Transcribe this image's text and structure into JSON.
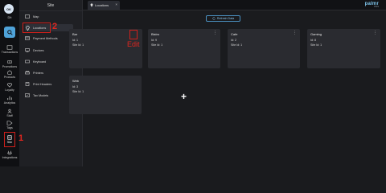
{
  "rail": {
    "avatar_initials": "OK",
    "user_label": "Dit",
    "items": [
      {
        "label": "Transactions",
        "icon": "transactions-icon"
      },
      {
        "label": "Promotions",
        "icon": "promotions-icon"
      },
      {
        "label": "Products",
        "icon": "products-icon"
      },
      {
        "label": "Loyalty",
        "icon": "loyalty-icon"
      },
      {
        "label": "Analytics",
        "icon": "analytics-icon"
      },
      {
        "label": "Staff",
        "icon": "staff-icon"
      },
      {
        "label": "Tags",
        "icon": "tags-icon"
      },
      {
        "label": "Site",
        "icon": "site-icon"
      },
      {
        "label": "Integrations",
        "icon": "integrations-icon"
      }
    ]
  },
  "panel": {
    "title": "Site",
    "items": [
      {
        "label": "Map",
        "icon": "map-icon"
      },
      {
        "label": "Locations",
        "icon": "location-pin-icon"
      },
      {
        "label": "Payment Methods",
        "icon": "payment-icon"
      },
      {
        "label": "Devices",
        "icon": "devices-icon"
      },
      {
        "label": "Keyboard",
        "icon": "keyboard-icon"
      },
      {
        "label": "Printers",
        "icon": "printer-icon"
      },
      {
        "label": "Print Headers",
        "icon": "print-headers-icon"
      },
      {
        "label": "Tax Models",
        "icon": "tax-icon"
      }
    ]
  },
  "topbar": {
    "tab_label": "Locations",
    "tab_close": "×",
    "logo": "palmr",
    "logo_sub": "POS"
  },
  "main": {
    "refresh_label": "Refresh Data",
    "cards": [
      {
        "name": "Bar",
        "id_line": "Id: 1",
        "site_line": "Site Id: 1"
      },
      {
        "name": "Bistro",
        "id_line": "Id: 9",
        "site_line": "Site Id: 1"
      },
      {
        "name": "Cafe",
        "id_line": "Id: 2",
        "site_line": "Site Id: 1"
      },
      {
        "name": "Gaming",
        "id_line": "Id: 8",
        "site_line": "Site Id: 1"
      },
      {
        "name": "Web",
        "id_line": "Id: 3",
        "site_line": "Site Id: 1"
      }
    ],
    "add_symbol": "+"
  },
  "annotations": {
    "step1": "1",
    "step2": "2",
    "edit": "Edit"
  },
  "colors": {
    "accent": "#4fa3d9",
    "annotation": "#e0261f",
    "card_bg": "#2a2b30"
  }
}
